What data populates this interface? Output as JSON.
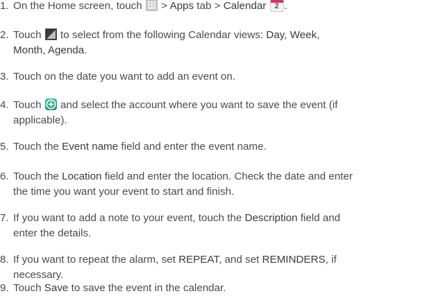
{
  "steps": [
    {
      "num": "1.",
      "lines": [
        {
          "parts": [
            {
              "t": "On the Home screen, touch "
            },
            {
              "icon": "apps-grid-icon"
            },
            {
              "t": " > "
            },
            {
              "t": "Apps",
              "b": 1
            },
            {
              "t": " tab > "
            },
            {
              "t": "Calendar",
              "b": 1
            },
            {
              "t": " "
            },
            {
              "icon": "calendar-app-icon"
            },
            {
              "t": "."
            }
          ]
        }
      ]
    },
    {
      "num": "2.",
      "lines": [
        {
          "parts": [
            {
              "t": "Touch "
            },
            {
              "icon": "view-switch-icon"
            },
            {
              "t": " to select from the following Calendar views: "
            },
            {
              "t": "Day",
              "b": 1
            },
            {
              "t": ", "
            },
            {
              "t": "Week",
              "b": 1
            },
            {
              "t": ","
            }
          ]
        },
        {
          "parts": [
            {
              "t": "Month",
              "b": 1
            },
            {
              "t": ", "
            },
            {
              "t": "Agenda",
              "b": 1
            },
            {
              "t": "."
            }
          ]
        }
      ]
    },
    {
      "num": "3.",
      "lines": [
        {
          "parts": [
            {
              "t": "Touch on the date you want to add an event on."
            }
          ]
        }
      ]
    },
    {
      "num": "4.",
      "lines": [
        {
          "parts": [
            {
              "t": "Touch "
            },
            {
              "icon": "add-event-icon"
            },
            {
              "t": " and select the account where you want to save the event (if"
            }
          ]
        },
        {
          "parts": [
            {
              "t": "applicable)."
            }
          ]
        }
      ]
    },
    {
      "num": "5.",
      "lines": [
        {
          "parts": [
            {
              "t": "Touch the "
            },
            {
              "t": "Event name",
              "b": 1
            },
            {
              "t": " field and enter the event name."
            }
          ]
        }
      ]
    },
    {
      "num": "6.",
      "lines": [
        {
          "parts": [
            {
              "t": "Touch the "
            },
            {
              "t": "Location",
              "b": 1
            },
            {
              "t": " field and enter the location. Check the date and enter"
            }
          ]
        },
        {
          "parts": [
            {
              "t": "the time you want your event to start and finish."
            }
          ]
        }
      ]
    },
    {
      "num": "7.",
      "lines": [
        {
          "parts": [
            {
              "t": "If you want to add a note to your event, touch the "
            },
            {
              "t": "Description",
              "b": 1
            },
            {
              "t": " field and"
            }
          ]
        },
        {
          "parts": [
            {
              "t": "enter the details."
            }
          ]
        }
      ]
    },
    {
      "num": "8.",
      "lines": [
        {
          "parts": [
            {
              "t": "If you want to repeat the alarm, set "
            },
            {
              "t": "REPEAT",
              "b": 1
            },
            {
              "t": ", and set "
            },
            {
              "t": "REMINDERS",
              "b": 1
            },
            {
              "t": ", if"
            }
          ]
        },
        {
          "parts": [
            {
              "t": "necessary."
            }
          ]
        }
      ]
    },
    {
      "num": "9.",
      "lines": [
        {
          "parts": [
            {
              "t": "Touch "
            },
            {
              "t": "Save",
              "b": 1
            },
            {
              "t": " to save the event in the calendar."
            }
          ]
        }
      ]
    }
  ],
  "calendar_icon_day": "2",
  "colors": {
    "text": "#4a4a4a",
    "calendar_header": "#d8325f",
    "add_icon": "#2aa37f"
  }
}
